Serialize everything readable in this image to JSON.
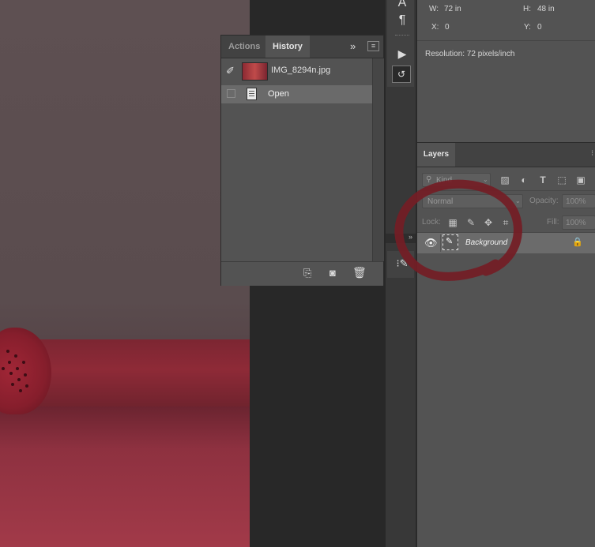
{
  "history_panel": {
    "tabs": [
      "Actions",
      "History"
    ],
    "active_tab": "History",
    "snapshot_name": "IMG_8294n.jpg",
    "steps": [
      {
        "label": "Open"
      }
    ],
    "bottom_icons": [
      "new-document-from-state-icon",
      "snapshot-camera-icon",
      "delete-trash-icon"
    ]
  },
  "info_panel": {
    "w_label": "W:",
    "w_value": "72 in",
    "h_label": "H:",
    "h_value": "48 in",
    "x_label": "X:",
    "x_value": "0",
    "y_label": "Y:",
    "y_value": "0",
    "resolution": "Resolution: 72 pixels/inch"
  },
  "layers_panel": {
    "tab_label": "Layers",
    "filter_placeholder": "Kind",
    "blend_mode": "Normal",
    "opacity_label": "Opacity:",
    "opacity_value": "100%",
    "lock_label": "Lock:",
    "fill_label": "Fill:",
    "fill_value": "100%",
    "layers": [
      {
        "name": "Background",
        "visible": true,
        "locked": true
      }
    ]
  },
  "annotation": {
    "shape": "hand-drawn circle",
    "color": "#7a1f26"
  },
  "colors": {
    "panel": "#535353",
    "tabbar": "#424242",
    "selected_row": "#6b6b6b",
    "workspace": "#282828"
  }
}
